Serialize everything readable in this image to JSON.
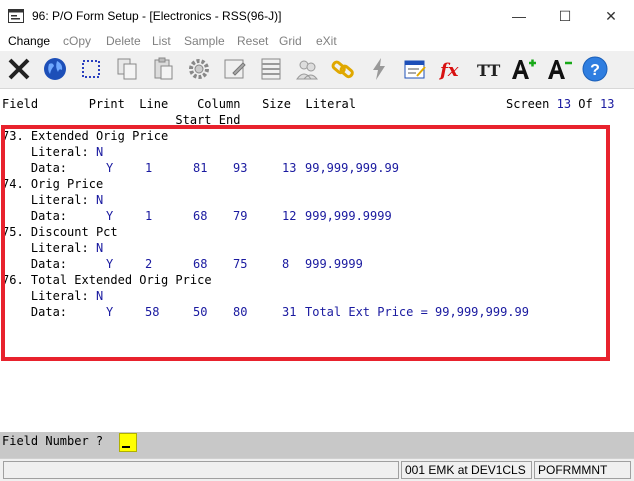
{
  "window": {
    "title": "96: P/O Form Setup - [Electronics - RSS(96-J)]",
    "min_glyph": "—",
    "max_glyph": "☐",
    "close_glyph": "✕"
  },
  "menu": [
    {
      "label": "Change",
      "enabled": true
    },
    {
      "label": "cOpy",
      "enabled": false
    },
    {
      "label": "Delete",
      "enabled": false
    },
    {
      "label": "List",
      "enabled": false
    },
    {
      "label": "Sample",
      "enabled": false
    },
    {
      "label": "Reset",
      "enabled": false
    },
    {
      "label": "Grid",
      "enabled": false
    },
    {
      "label": "eXit",
      "enabled": false
    }
  ],
  "toolbar_icons": [
    "close-x-icon",
    "globe-icon",
    "select-dotted-icon",
    "copy-docs-icon",
    "paste-clipboard-icon",
    "settings-gear-icon",
    "edit-form-icon",
    "list-grid-icon",
    "users-icon",
    "link-chain-icon",
    "lightning-icon",
    "window-edit-icon",
    "function-fx-icon",
    "font-size-icon",
    "increase-font-icon",
    "decrease-font-icon",
    "help-icon"
  ],
  "toolbar_fx": "fx",
  "toolbar_tt": "TT",
  "toolbar_help": "?",
  "header": {
    "line1": "Field       Print  Line    Column   Size  Literal",
    "screen_label": "Screen",
    "screen_num": "13",
    "of_label": "Of",
    "of_num": "13",
    "line2": "                        Start End"
  },
  "fields": [
    {
      "num": "73.",
      "name": "Extended Orig Price",
      "literal_label": "Literal:",
      "literal_value": "N",
      "data_label": "Data:",
      "print": "Y",
      "line": "1",
      "start": "81",
      "end": "93",
      "size": "13",
      "literal": "99,999,999.99"
    },
    {
      "num": "74.",
      "name": "Orig Price",
      "literal_label": "Literal:",
      "literal_value": "N",
      "data_label": "Data:",
      "print": "Y",
      "line": "1",
      "start": "68",
      "end": "79",
      "size": "12",
      "literal": "999,999.9999"
    },
    {
      "num": "75.",
      "name": "Discount Pct",
      "literal_label": "Literal:",
      "literal_value": "N",
      "data_label": "Data:",
      "print": "Y",
      "line": "2",
      "start": "68",
      "end": "75",
      "size": "8",
      "literal": "999.9999"
    },
    {
      "num": "76.",
      "name": "Total Extended Orig Price",
      "literal_label": "Literal:",
      "literal_value": "N",
      "data_label": "Data:",
      "print": "Y",
      "line": "58",
      "start": "50",
      "end": "80",
      "size": "31",
      "literal": "Total Ext Price = 99,999,999.99"
    }
  ],
  "prompt": {
    "label": "Field Number ?",
    "value": ""
  },
  "status": {
    "user": "001 EMK at DEV1CLS",
    "program": "POFRMMNT"
  },
  "colors": {
    "highlight": "#e8222d",
    "blue_text": "#1a1aa0",
    "input_bg": "#ffff00"
  }
}
